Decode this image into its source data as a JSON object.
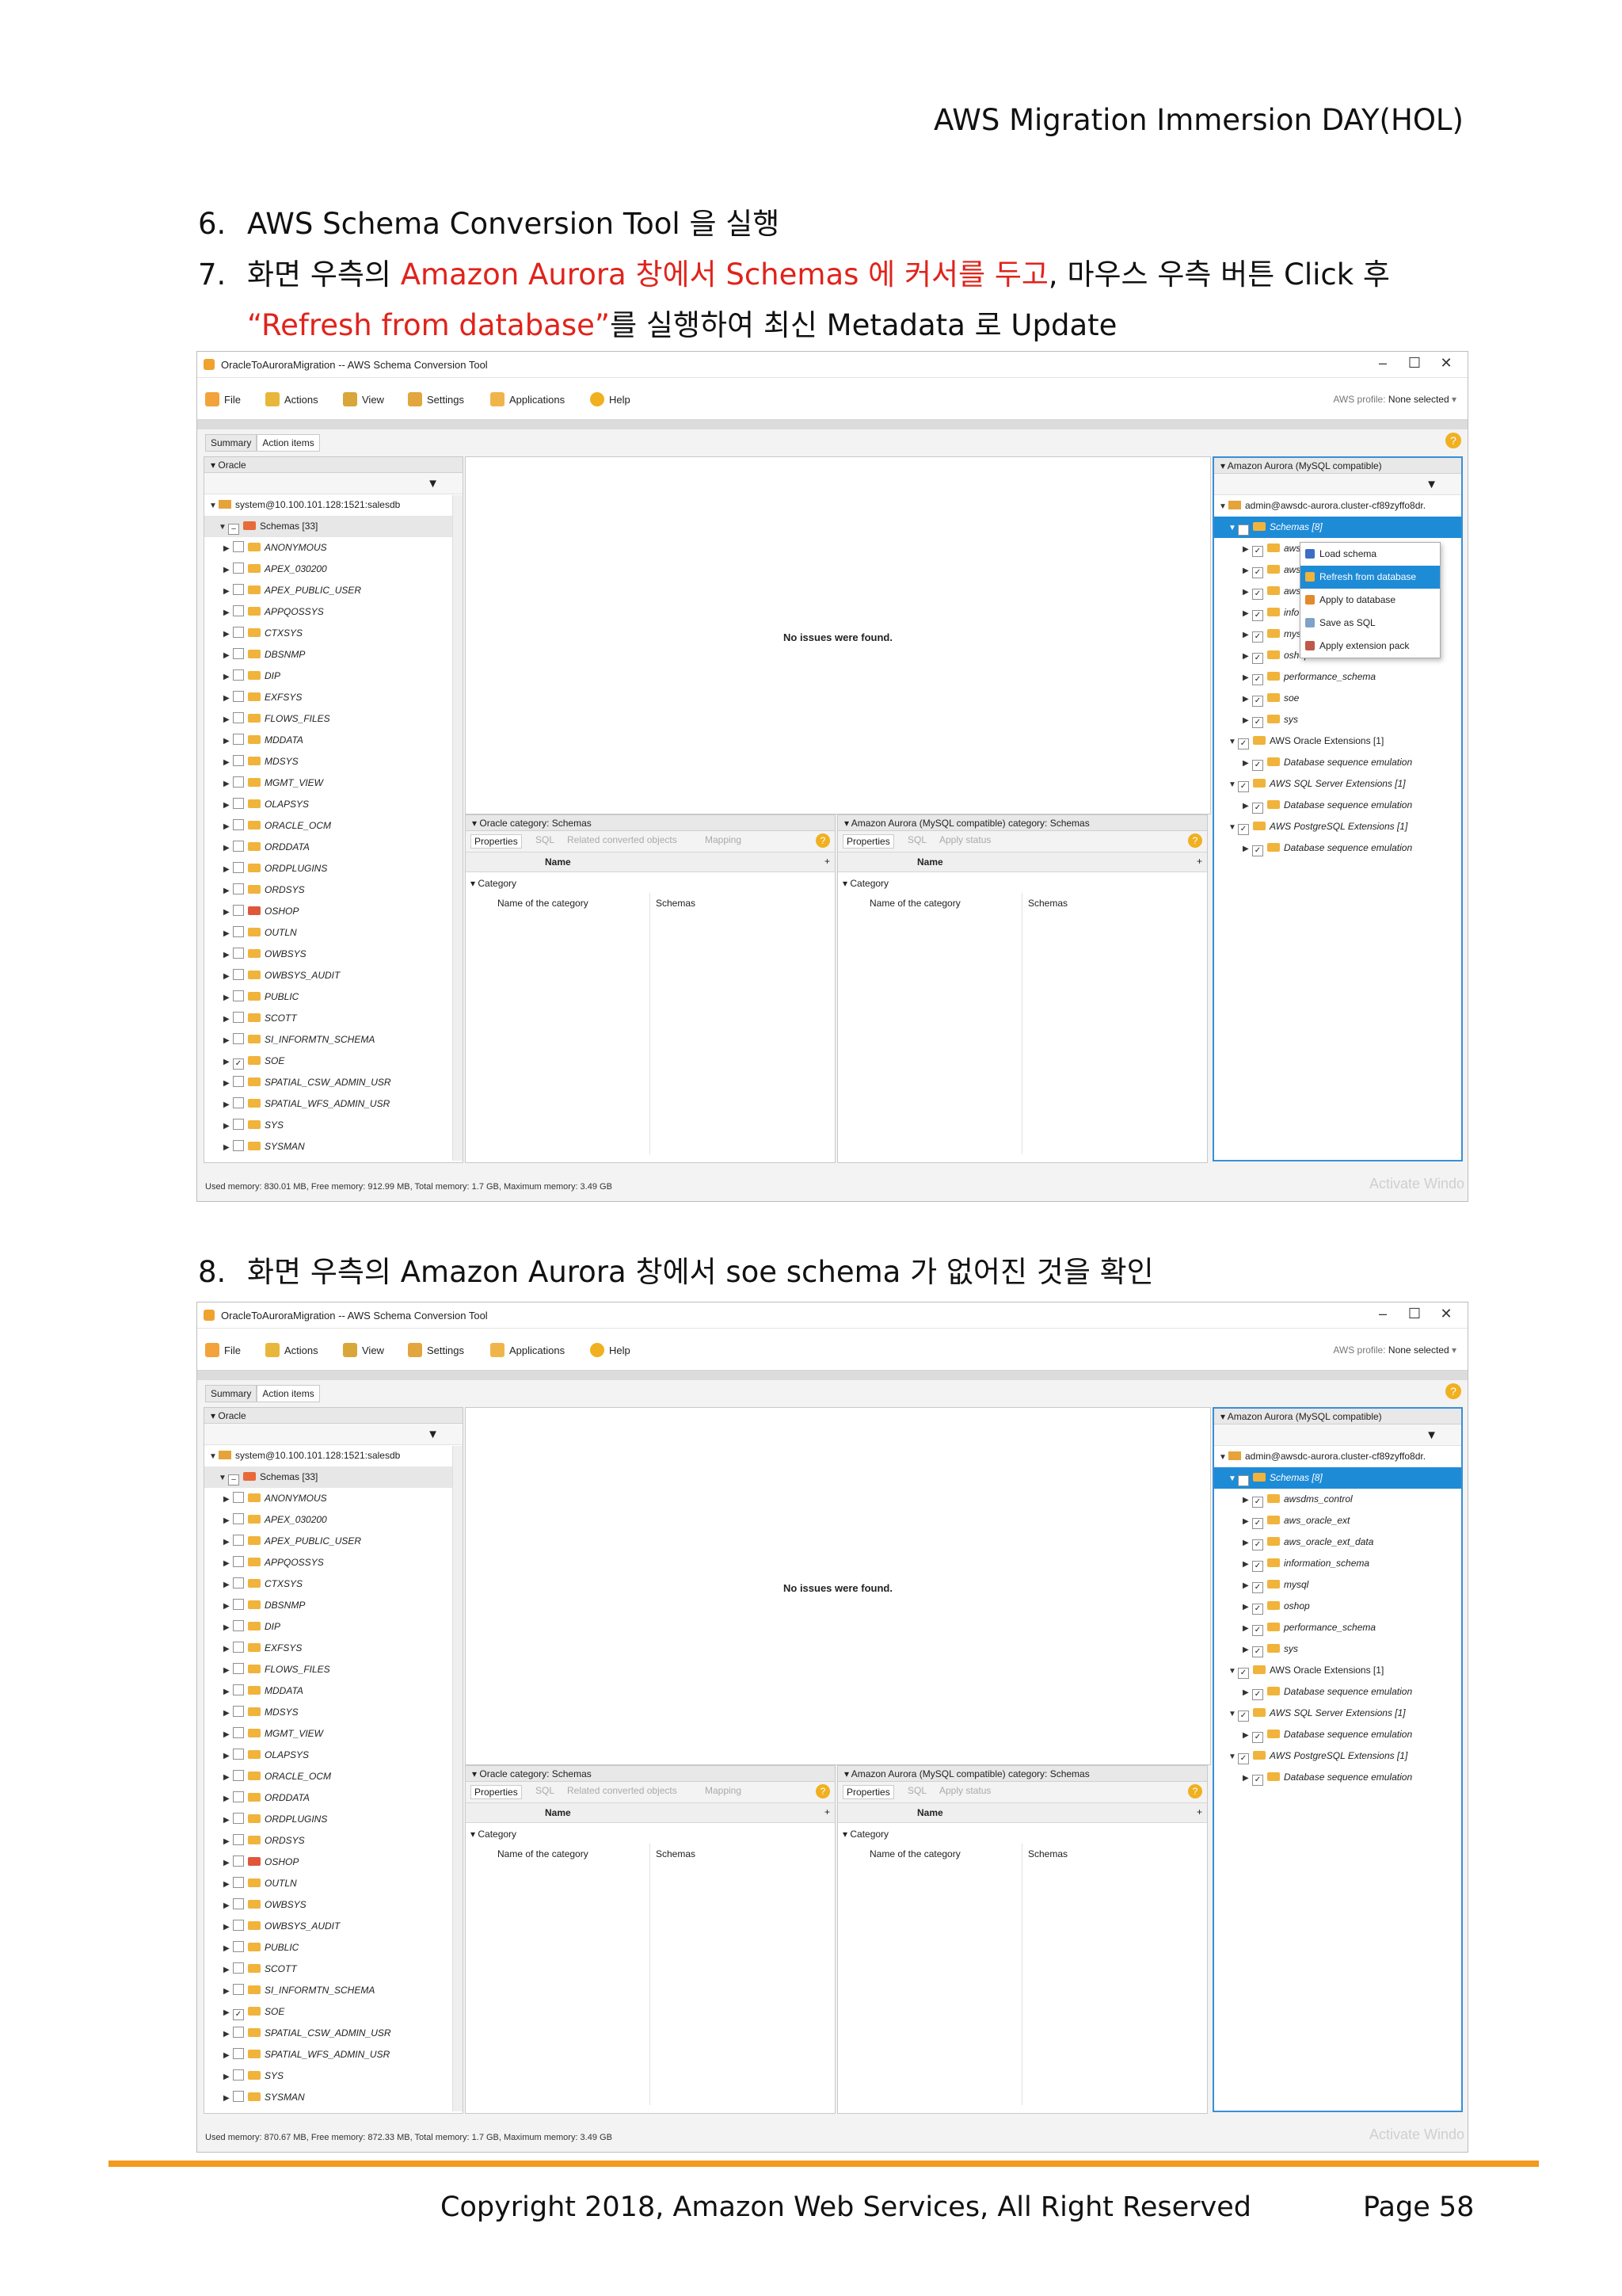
{
  "header": {
    "title": "AWS Migration Immersion DAY(HOL)"
  },
  "steps": {
    "s6": {
      "num": "6.",
      "text": "AWS Schema Conversion Tool 을 실행"
    },
    "s7": {
      "num": "7.",
      "p1": "화면 우측의 ",
      "p2": "Amazon Aurora 창에서 Schemas 에 커서를 두고",
      "p3": ", 마우스 우측 버튼 Click 후",
      "p4": "“Refresh from database”",
      "p5": "를 실행하여 최신 Metadata 로 Update"
    },
    "s8": {
      "num": "8.",
      "text": "화면 우측의 Amazon Aurora 창에서 soe schema 가 없어진 것을 확인"
    }
  },
  "footer": {
    "copyright": "Copyright 2018, Amazon Web Services, All Right Reserved",
    "page": "Page 58"
  },
  "app": {
    "title": "OracleToAuroraMigration -- AWS Schema Conversion Tool",
    "controls": {
      "minimize": "–",
      "maximize": "☐",
      "close": "✕"
    },
    "toolbar": {
      "file": "File",
      "actions": "Actions",
      "view": "View",
      "settings": "Settings",
      "applications": "Applications",
      "help": "Help"
    },
    "profile_label": "AWS profile:",
    "profile_value": "None selected",
    "tabs": {
      "summary": "Summary",
      "action_items": "Action items"
    },
    "left_title": "Oracle",
    "left_conn": "system@10.100.101.128:1521:salesdb",
    "left_schemas": "Schemas [33]",
    "left_items": [
      "ANONYMOUS",
      "APEX_030200",
      "APEX_PUBLIC_USER",
      "APPQOSSYS",
      "CTXSYS",
      "DBSNMP",
      "DIP",
      "EXFSYS",
      "FLOWS_FILES",
      "MDDATA",
      "MDSYS",
      "MGMT_VIEW",
      "OLAPSYS",
      "ORACLE_OCM",
      "ORDDATA",
      "ORDPLUGINS",
      "ORDSYS",
      "OSHOP",
      "OUTLN",
      "OWBSYS",
      "OWBSYS_AUDIT",
      "PUBLIC",
      "SCOTT",
      "SI_INFORMTN_SCHEMA",
      "SOE",
      "SPATIAL_CSW_ADMIN_USR",
      "SPATIAL_WFS_ADMIN_USR",
      "SYS",
      "SYSMAN"
    ],
    "no_issues": "No issues were found.",
    "oracle_category": "Oracle category: Schemas",
    "aurora_category": "Amazon Aurora (MySQL compatible) category: Schemas",
    "sub_tabs_left": [
      "Properties",
      "SQL",
      "Related converted objects",
      "Mapping"
    ],
    "sub_tabs_right": [
      "Properties",
      "SQL",
      "Apply status"
    ],
    "col_name": "Name",
    "category": "Category",
    "name_of_category": "Name of the category",
    "schemas_value": "Schemas",
    "right_title": "Amazon Aurora (MySQL compatible)",
    "right_conn": "admin@awsdc-aurora.cluster-cf89zyffo8dr.",
    "right_schemas": "Schemas [8]",
    "watermark": "Activate Windo"
  },
  "shot1": {
    "right_items": [
      "aws",
      "aws",
      "aws",
      "info",
      "mys",
      "oshop",
      "performance_schema",
      "soe",
      "sys"
    ],
    "ext": [
      "AWS Oracle Extensions [1]",
      "Database sequence emulation",
      "AWS SQL Server Extensions [1]",
      "Database sequence emulation",
      "AWS PostgreSQL Extensions [1]",
      "Database sequence emulation"
    ],
    "menu": [
      "Load schema",
      "Refresh from database",
      "Apply to database",
      "Save as SQL",
      "Apply extension pack"
    ],
    "status": "Used memory: 830.01 MB,    Free memory: 912.99 MB,    Total memory: 1.7 GB,    Maximum memory: 3.49 GB"
  },
  "shot2": {
    "right_items": [
      "awsdms_control",
      "aws_oracle_ext",
      "aws_oracle_ext_data",
      "information_schema",
      "mysql",
      "oshop",
      "performance_schema",
      "sys"
    ],
    "ext": [
      "AWS Oracle Extensions [1]",
      "Database sequence emulation",
      "AWS SQL Server Extensions [1]",
      "Database sequence emulation",
      "AWS PostgreSQL Extensions [1]",
      "Database sequence emulation"
    ],
    "status": "Used memory: 870.67 MB,    Free memory: 872.33 MB,    Total memory: 1.7 GB,    Maximum memory: 3.49 GB"
  },
  "colors": {
    "accent_red": "#e0231b",
    "rule_orange": "#f39a1f",
    "selection_blue": "#1e8bd7"
  }
}
